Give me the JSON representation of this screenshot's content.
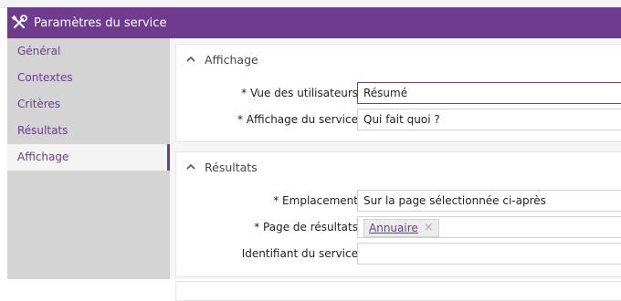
{
  "dialog": {
    "title": "Paramètres du service",
    "title_icon": "tools-icon"
  },
  "colors": {
    "accent": "#6e3b8f",
    "sidebar_bg": "#d4d4d4",
    "content_bg": "#f6f6f6"
  },
  "sidebar": {
    "items": [
      {
        "label": "Général"
      },
      {
        "label": "Contextes"
      },
      {
        "label": "Critères"
      },
      {
        "label": "Résultats"
      },
      {
        "label": "Affichage",
        "active": true
      }
    ]
  },
  "sections": [
    {
      "title": "Affichage",
      "icon": "chevron-up-icon",
      "fields": [
        {
          "label": "* Vue des utilisateurs",
          "value": "Résumé"
        },
        {
          "label": "* Affichage du service",
          "value": "Qui fait quoi ?"
        }
      ]
    },
    {
      "title": "Résultats",
      "icon": "chevron-up-icon",
      "fields": [
        {
          "label": "* Emplacement",
          "value": "Sur la page sélectionnée ci-après"
        },
        {
          "label": "* Page de résultats",
          "tag": "Annuaire",
          "tag_remove": "×"
        },
        {
          "label": "Identifiant du service",
          "value": ""
        }
      ]
    }
  ]
}
